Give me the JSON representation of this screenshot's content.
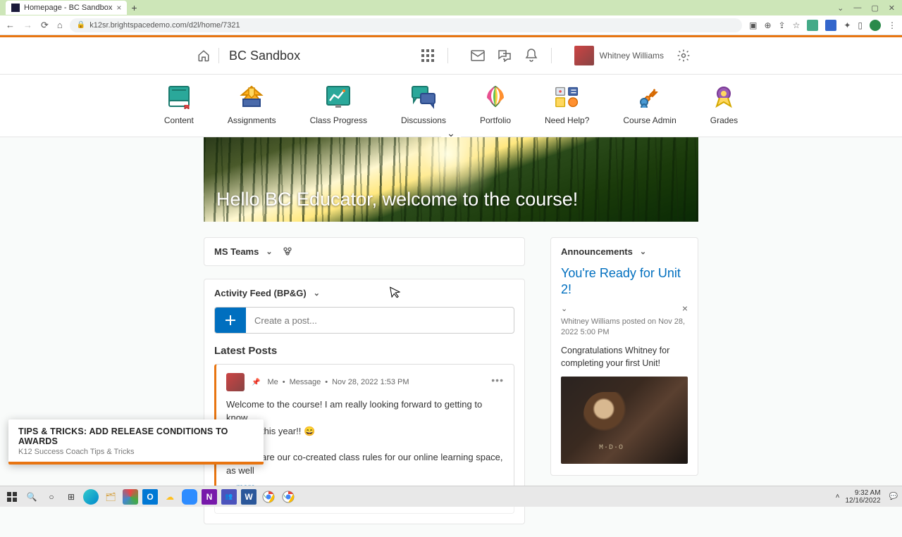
{
  "browser": {
    "tab_title": "Homepage - BC Sandbox",
    "url": "k12sr.brightspacedemo.com/d2l/home/7321"
  },
  "topnav": {
    "course_title": "BC Sandbox",
    "user_name": "Whitney Williams"
  },
  "coursenav": [
    {
      "label": "Content"
    },
    {
      "label": "Assignments"
    },
    {
      "label": "Class Progress"
    },
    {
      "label": "Discussions"
    },
    {
      "label": "Portfolio"
    },
    {
      "label": "Need Help?"
    },
    {
      "label": "Course Admin"
    },
    {
      "label": "Grades"
    }
  ],
  "banner": {
    "greeting": "Hello BC Educator, welcome to the course!"
  },
  "widgets": {
    "msteams": {
      "title": "MS Teams"
    },
    "activity_feed": {
      "title": "Activity Feed (BP&G)",
      "create_placeholder": "Create a post...",
      "latest_heading": "Latest Posts",
      "post": {
        "author": "Me",
        "type": "Message",
        "timestamp": "Nov 28, 2022 1:53 PM",
        "body_line1": "Welcome to the course! I am really looking forward to getting to know",
        "body_line2": "this year!! 😄",
        "body_line3": "are our co-created class rules for our online learning space, as well",
        "more": "more"
      }
    },
    "announcements": {
      "title": "Announcements",
      "item": {
        "heading": "You're Ready for Unit 2!",
        "meta": "Whitney Williams posted on Nov 28, 2022 5:00 PM",
        "body": "Congratulations Whitney for completing your first Unit!"
      }
    }
  },
  "toast": {
    "title": "TIPS & TRICKS: ADD RELEASE CONDITIONS TO AWARDS",
    "subtitle": "K12 Success Coach Tips & Tricks"
  },
  "taskbar": {
    "time": "9:32 AM",
    "date": "12/16/2022"
  }
}
